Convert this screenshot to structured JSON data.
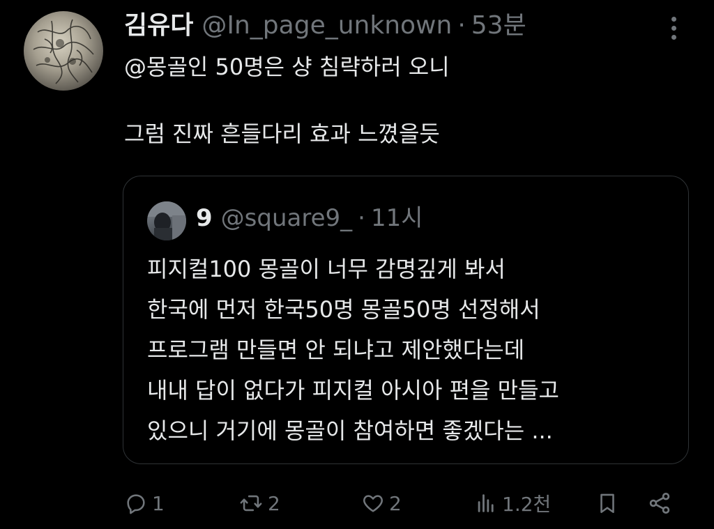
{
  "tweet": {
    "display_name": "김유다",
    "handle": "@In_page_unknown",
    "separator": "·",
    "time": "53분",
    "text": "@몽골인 50명은 샹 침략하러 오니\n\n그럼 진짜 흔들다리 효과 느꼈을듯",
    "avatar_icon": "engraving-artwork-avatar",
    "more_icon": "more-dots-icon"
  },
  "quote": {
    "display_name": "9",
    "handle": "@square9_",
    "separator": "·",
    "time": "11시",
    "text": "피지컬100 몽골이 너무 감명깊게 봐서\n한국에 먼저 한국50명 몽골50명 선정해서\n프로그램 만들면 안 되냐고 제안했다는데\n내내 답이 없다가 피지컬 아시아 편을 만들고\n있으니 거기에 몽골이 참여하면 좋겠다는 ..."
  },
  "actions": {
    "reply_count": "1",
    "retweet_count": "2",
    "like_count": "2",
    "views_count": "1.2천"
  },
  "colors": {
    "background": "#000000",
    "text": "#e7e9ea",
    "muted": "#71767b",
    "border": "#2f3336"
  }
}
